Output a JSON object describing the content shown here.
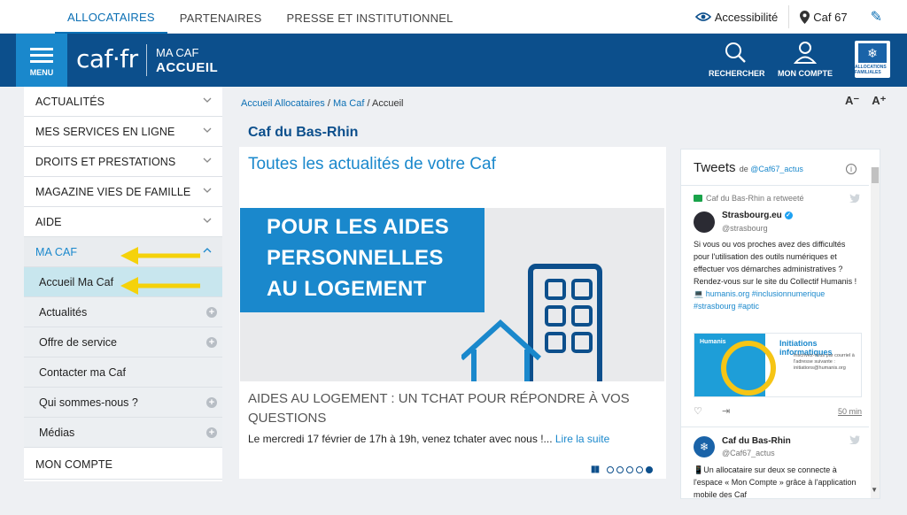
{
  "topnav": {
    "items": [
      "ALLOCATAIRES",
      "PARTENAIRES",
      "PRESSE ET INSTITUTIONNEL"
    ],
    "accessibility": "Accessibilité",
    "caf_location": "Caf 67"
  },
  "header": {
    "menu_label": "MENU",
    "logo_text": "caf·fr",
    "section_small": "MA CAF",
    "section_big": "ACCUEIL",
    "search_label": "RECHERCHER",
    "account_label": "MON COMPTE",
    "logo_caption": "ALLOCATIONS FAMILIALES"
  },
  "sidebar": {
    "items": [
      "ACTUALITÉS",
      "MES SERVICES EN LIGNE",
      "DROITS ET PRESTATIONS",
      "MAGAZINE VIES DE FAMILLE",
      "AIDE",
      "MA CAF"
    ],
    "sub_items": [
      "Accueil Ma Caf",
      "Actualités",
      "Offre de service",
      "Contacter ma Caf",
      "Qui sommes-nous ?",
      "Médias"
    ],
    "bottom_item": "MON COMPTE",
    "active_sub": "Accueil Ma Caf"
  },
  "breadcrumb": {
    "link1": "Accueil Allocataires",
    "sep": "/",
    "link2": "Ma Caf",
    "current": "Accueil"
  },
  "fontsize": {
    "decrease": "A⁻",
    "increase": "A⁺"
  },
  "page_title": "Caf du Bas-Rhin",
  "news": {
    "heading": "Toutes les actualités de votre Caf",
    "hero_lines": [
      "POUR LES AIDES",
      "PERSONNELLES",
      "AU LOGEMENT"
    ],
    "title": "AIDES AU LOGEMENT : UN TCHAT POUR RÉPONDRE À VOS QUESTIONS",
    "text": "Le mercredi 17 février de 17h à 19h, venez tchater avec nous !...",
    "more": "Lire la suite",
    "slide_count": 5,
    "active_slide": 5
  },
  "twitter": {
    "title": "Tweets",
    "by": "de",
    "account": "@Caf67_actus",
    "retweet_label": "Caf du Bas-Rhin a retweeté",
    "tweet1": {
      "name": "Strasbourg.eu",
      "handle": "@strasbourg",
      "body": "Si vous ou vos proches avez des difficultés pour l'utilisation des outils numériques et effectuer vos démarches administratives ? Rendez-vous sur le site du Collectif Humanis !",
      "links": "💻 humanis.org #inclusionnumerique #strasbourg #aptic",
      "image_title": "Initiations informatiques",
      "image_sub": "Inscrivez-vous par courriel à l'adresse suivante : initiations@humanis.org",
      "image_brand": "Humanis",
      "time": "50 min"
    },
    "tweet2": {
      "name": "Caf du Bas-Rhin",
      "handle": "@Caf67_actus",
      "body": "📱Un allocataire sur deux se connecte à l'espace « Mon Compte » grâce à l'application mobile des Caf"
    }
  },
  "colors": {
    "header_blue": "#0c4f8c",
    "accent_blue": "#1a88cc",
    "arrow_yellow": "#f5d20a",
    "active_sub_bg": "#c8e6ee"
  }
}
